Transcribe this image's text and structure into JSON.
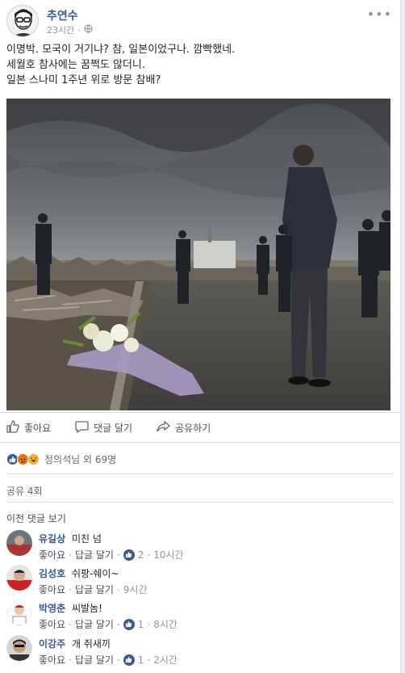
{
  "post": {
    "author": "추연수",
    "time": "23시간",
    "privacy_icon": "globe-icon",
    "lines": [
      "이명박. 모국이 거기냐? 참, 일본이었구나. 깜빡했네.",
      "세월호 참사에는 꿈쩍도 않더니.",
      "일본 스나미 1주년 위로 방문 참배?"
    ]
  },
  "actions": {
    "like": "좋아요",
    "comment": "댓글 달기",
    "share": "공유하기"
  },
  "reactions": {
    "icons": [
      "like-icon",
      "angry-icon",
      "haha-icon"
    ],
    "summary": "정의석님 외 69명"
  },
  "shares": "공유 4회",
  "previous_comments": "이전 댓글 보기",
  "comments": [
    {
      "name": "유길상",
      "text": "미친 넘",
      "like": "좋아요",
      "reply": "답글 달기",
      "likes": "2",
      "time": "10시간"
    },
    {
      "name": "김성호",
      "text": "쉬팡-쉐이~",
      "like": "좋아요",
      "reply": "답글 달기",
      "likes": "",
      "time": "9시간"
    },
    {
      "name": "박영춘",
      "text": "씨발놈!",
      "like": "좋아요",
      "reply": "답글 달기",
      "likes": "1",
      "time": "8시간"
    },
    {
      "name": "이강주",
      "text": "개 쥐새끼",
      "like": "좋아요",
      "reply": "답글 달기",
      "likes": "1",
      "time": "2시간"
    }
  ],
  "colors": {
    "link": "#365899",
    "like": "#3b5998",
    "meta": "#90949c"
  }
}
